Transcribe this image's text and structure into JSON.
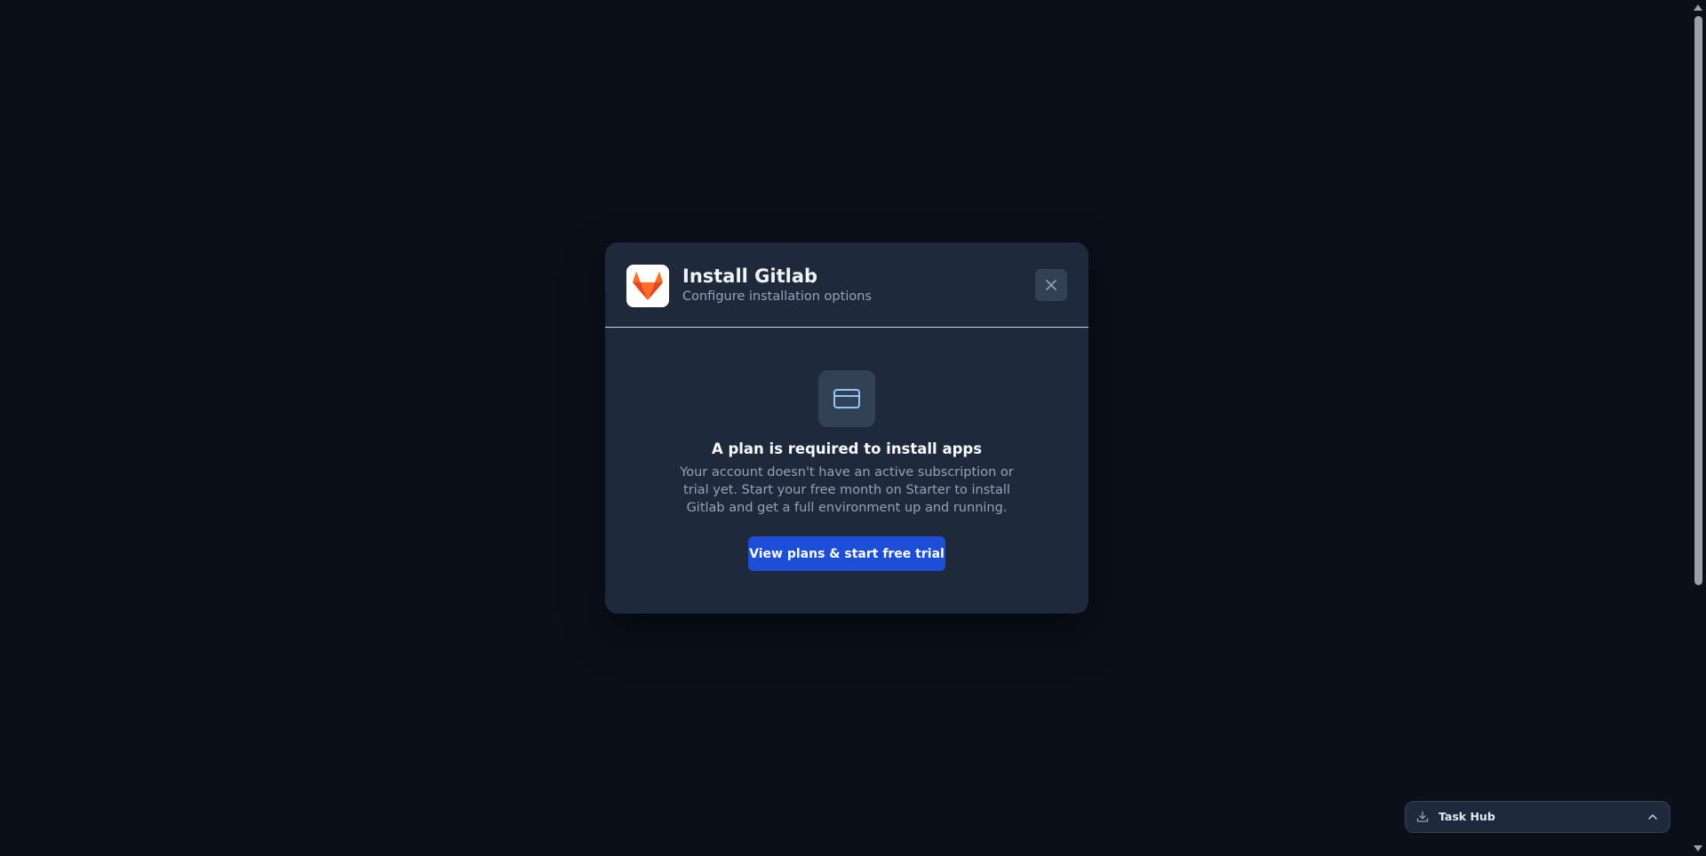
{
  "modal": {
    "title": "Install Gitlab",
    "subtitle": "Configure installation options",
    "app_icon": "gitlab-logo",
    "close_icon": "close-icon",
    "notice": {
      "icon": "credit-card-icon",
      "title": "A plan is required to install apps",
      "text": "Your account doesn't have an active subscription or trial yet. Start your free month on Starter to install Gitlab and get a full environment up and running.",
      "cta_label": "View plans & start free trial"
    }
  },
  "task_hub": {
    "label": "Task Hub",
    "icon": "download-icon",
    "toggle_icon": "chevron-up-icon"
  },
  "colors": {
    "background": "#0a0f1a",
    "modal_bg": "#1e293b",
    "accent": "#1d4ed8",
    "muted_text": "#94a3b8"
  }
}
